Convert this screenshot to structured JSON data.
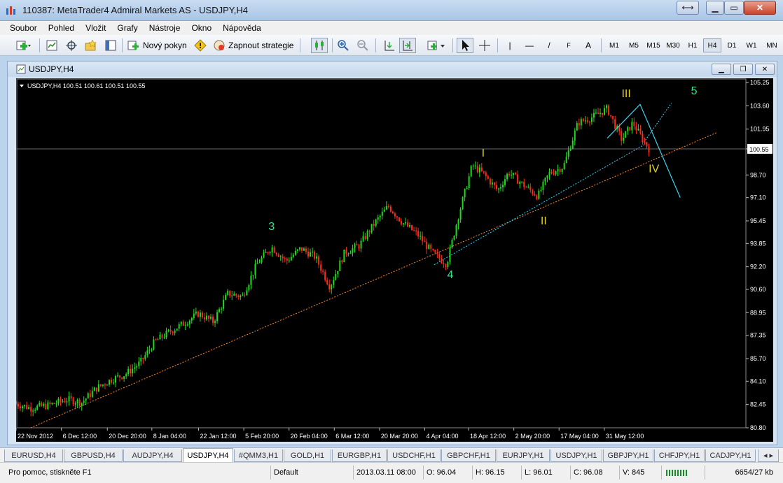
{
  "window": {
    "title": "110387: MetaTrader4 Admiral Markets AS - USDJPY,H4"
  },
  "menu": [
    "Soubor",
    "Pohled",
    "Vložit",
    "Grafy",
    "Nástroje",
    "Okno",
    "Nápověda"
  ],
  "toolbar": {
    "new_order": "Nový pokyn",
    "strategy": "Zapnout strategie",
    "line_tools": [
      "|",
      "—",
      "/",
      "F",
      "A"
    ],
    "timeframes": [
      "M1",
      "M5",
      "M15",
      "M30",
      "H1",
      "H4",
      "D1",
      "W1",
      "MN"
    ],
    "active_timeframe": "H4"
  },
  "document": {
    "title": "USDJPY,H4"
  },
  "chart_data": {
    "type": "candlestick",
    "header": "USDJPY,H4  100.51 100.61 100.51 100.55",
    "current_price": "100.55",
    "ylim": [
      80.8,
      105.25
    ],
    "y_ticks": [
      "105.25",
      "103.60",
      "101.95",
      "100.55",
      "98.70",
      "97.10",
      "95.45",
      "93.85",
      "92.20",
      "90.60",
      "88.95",
      "87.35",
      "85.70",
      "84.10",
      "82.45",
      "80.80"
    ],
    "x_ticks": [
      "22 Nov 2012",
      "6 Dec 12:00",
      "20 Dec 20:00",
      "8 Jan 04:00",
      "22 Jan 12:00",
      "5 Feb 20:00",
      "20 Feb 04:00",
      "6 Mar 12:00",
      "20 Mar 20:00",
      "4 Apr 04:00",
      "18 Apr 12:00",
      "2 May 20:00",
      "17 May 04:00",
      "31 May 12:00"
    ],
    "series": [
      {
        "values": [
          [
            0,
            82.5
          ],
          [
            0.02,
            82.2
          ],
          [
            0.045,
            82.4
          ],
          [
            0.07,
            82.8
          ],
          [
            0.09,
            82.6
          ],
          [
            0.11,
            83.6
          ],
          [
            0.13,
            84.2
          ],
          [
            0.15,
            84.6
          ],
          [
            0.17,
            85.4
          ],
          [
            0.19,
            86.9
          ],
          [
            0.21,
            87.6
          ],
          [
            0.23,
            88.2
          ],
          [
            0.25,
            88.9
          ],
          [
            0.27,
            88.3
          ],
          [
            0.29,
            90.3
          ],
          [
            0.31,
            90.1
          ],
          [
            0.33,
            92.4
          ],
          [
            0.35,
            93.6
          ],
          [
            0.37,
            92.6
          ],
          [
            0.39,
            93.5
          ],
          [
            0.41,
            92.9
          ],
          [
            0.43,
            90.8
          ],
          [
            0.45,
            93.2
          ],
          [
            0.47,
            93.7
          ],
          [
            0.49,
            95.2
          ],
          [
            0.51,
            96.5
          ],
          [
            0.53,
            95.3
          ],
          [
            0.55,
            94.5
          ],
          [
            0.57,
            93.2
          ],
          [
            0.59,
            92.4
          ],
          [
            0.605,
            95.6
          ],
          [
            0.625,
            99.4
          ],
          [
            0.64,
            98.8
          ],
          [
            0.66,
            97.6
          ],
          [
            0.675,
            98.9
          ],
          [
            0.695,
            98.0
          ],
          [
            0.715,
            97.2
          ],
          [
            0.73,
            98.8
          ],
          [
            0.75,
            99.3
          ],
          [
            0.77,
            102.4
          ],
          [
            0.79,
            102.8
          ],
          [
            0.81,
            103.4
          ],
          [
            0.83,
            101.2
          ],
          [
            0.845,
            102.4
          ],
          [
            0.86,
            101.1
          ],
          [
            0.868,
            100.5
          ]
        ]
      }
    ],
    "wave_labels": [
      {
        "text": "3",
        "x": 0.35,
        "y": 94.8,
        "color": "#3fe08a"
      },
      {
        "text": "4",
        "x": 0.595,
        "y": 91.4,
        "color": "#3fe08a"
      },
      {
        "text": "I",
        "x": 0.64,
        "y": 100.0,
        "color": "#e2d21e"
      },
      {
        "text": "II",
        "x": 0.723,
        "y": 95.2,
        "color": "#e2d21e"
      },
      {
        "text": "III",
        "x": 0.836,
        "y": 104.2,
        "color": "#e2d21e"
      },
      {
        "text": "IV",
        "x": 0.874,
        "y": 98.9,
        "color": "#e2d21e"
      },
      {
        "text": "5",
        "x": 0.929,
        "y": 104.4,
        "color": "#3fe08a"
      }
    ],
    "colors": {
      "bull": "#1fdc1f",
      "bear": "#ff2a1a",
      "projection": "#39d4f0",
      "trend": "#ff8c2a",
      "grid": "#1e1e1e",
      "text": "#ffffff"
    }
  },
  "symbol_tabs": [
    "EURUSD,H4",
    "GBPUSD,H4",
    "AUDJPY,H4",
    "USDJPY,H4",
    "#QMM3,H1",
    "GOLD,H1",
    "EURGBP,H1",
    "USDCHF,H1",
    "GBPCHF,H1",
    "EURJPY,H1",
    "USDJPY,H1",
    "GBPJPY,H1",
    "CHFJPY,H1",
    "CADJPY,H1"
  ],
  "active_tab": "USDJPY,H4",
  "status": {
    "help": "Pro pomoc, stiskněte F1",
    "profile": "Default",
    "time": "2013.03.11 08:00",
    "open": "O: 96.04",
    "high": "H: 96.15",
    "low": "L: 96.01",
    "close": "C: 96.08",
    "volume": "V: 845",
    "traffic": "6654/27 kb"
  }
}
